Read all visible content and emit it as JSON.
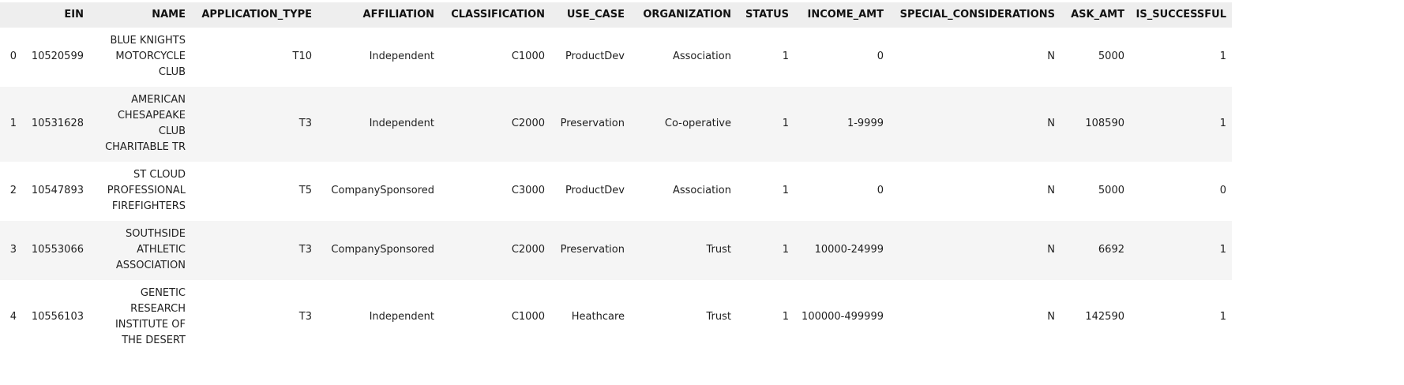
{
  "table": {
    "columns": [
      "",
      "EIN",
      "NAME",
      "APPLICATION_TYPE",
      "AFFILIATION",
      "CLASSIFICATION",
      "USE_CASE",
      "ORGANIZATION",
      "STATUS",
      "INCOME_AMT",
      "SPECIAL_CONSIDERATIONS",
      "ASK_AMT",
      "IS_SUCCESSFUL"
    ],
    "rows": [
      [
        "0",
        "10520599",
        "BLUE KNIGHTS MOTORCYCLE CLUB",
        "T10",
        "Independent",
        "C1000",
        "ProductDev",
        "Association",
        "1",
        "0",
        "N",
        "5000",
        "1"
      ],
      [
        "1",
        "10531628",
        "AMERICAN CHESAPEAKE CLUB CHARITABLE TR",
        "T3",
        "Independent",
        "C2000",
        "Preservation",
        "Co-operative",
        "1",
        "1-9999",
        "N",
        "108590",
        "1"
      ],
      [
        "2",
        "10547893",
        "ST CLOUD PROFESSIONAL FIREFIGHTERS",
        "T5",
        "CompanySponsored",
        "C3000",
        "ProductDev",
        "Association",
        "1",
        "0",
        "N",
        "5000",
        "0"
      ],
      [
        "3",
        "10553066",
        "SOUTHSIDE ATHLETIC ASSOCIATION",
        "T3",
        "CompanySponsored",
        "C2000",
        "Preservation",
        "Trust",
        "1",
        "10000-24999",
        "N",
        "6692",
        "1"
      ],
      [
        "4",
        "10556103",
        "GENETIC RESEARCH INSTITUTE OF THE DESERT",
        "T3",
        "Independent",
        "C1000",
        "Heathcare",
        "Trust",
        "1",
        "100000-499999",
        "N",
        "142590",
        "1"
      ]
    ]
  }
}
